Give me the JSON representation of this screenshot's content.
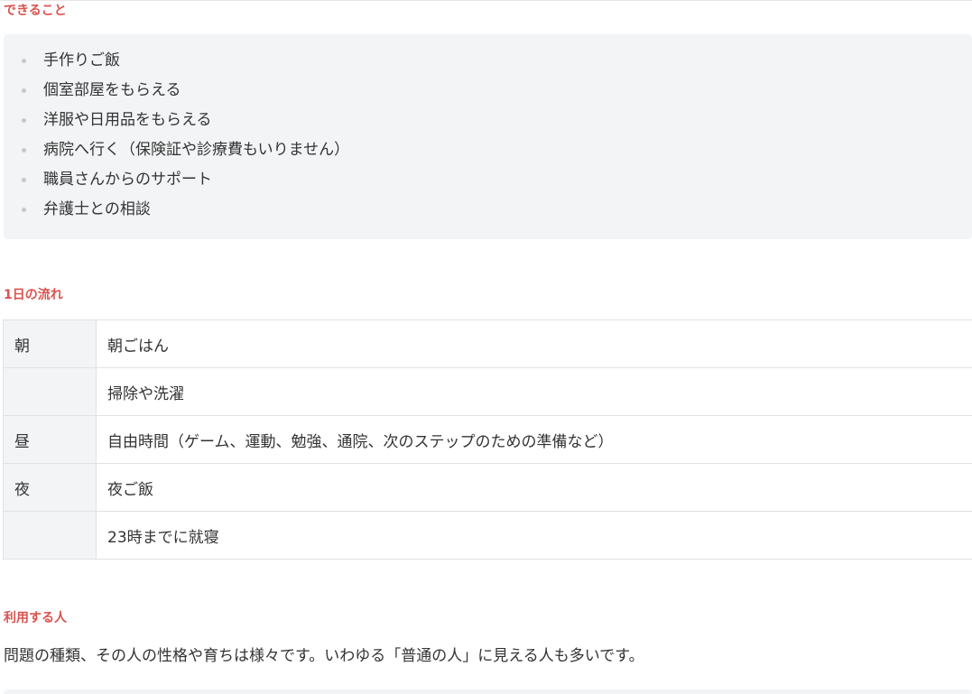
{
  "sections": {
    "can_do": {
      "heading": "できること",
      "items": [
        "手作りご飯",
        "個室部屋をもらえる",
        "洋服や日用品をもらえる",
        "病院へ行く（保険証や診療費もいりません）",
        "職員さんからのサポート",
        "弁護士との相談"
      ]
    },
    "day_flow": {
      "heading": "1日の流れ",
      "rows": [
        {
          "time": "朝",
          "activity": "朝ごはん"
        },
        {
          "time": "",
          "activity": "掃除や洗濯"
        },
        {
          "time": "昼",
          "activity": "自由時間（ゲーム、運動、勉強、通院、次のステップのための準備など）"
        },
        {
          "time": "夜",
          "activity": "夜ご飯"
        },
        {
          "time": "",
          "activity": "23時までに就寝"
        }
      ]
    },
    "users": {
      "heading": "利用する人",
      "paragraph": "問題の種類、その人の性格や育ちは様々です。いわゆる「普通の人」に見える人も多いです。"
    }
  },
  "colors": {
    "heading": "#d9534f",
    "box_background": "#f3f4f6",
    "text": "#333333"
  }
}
